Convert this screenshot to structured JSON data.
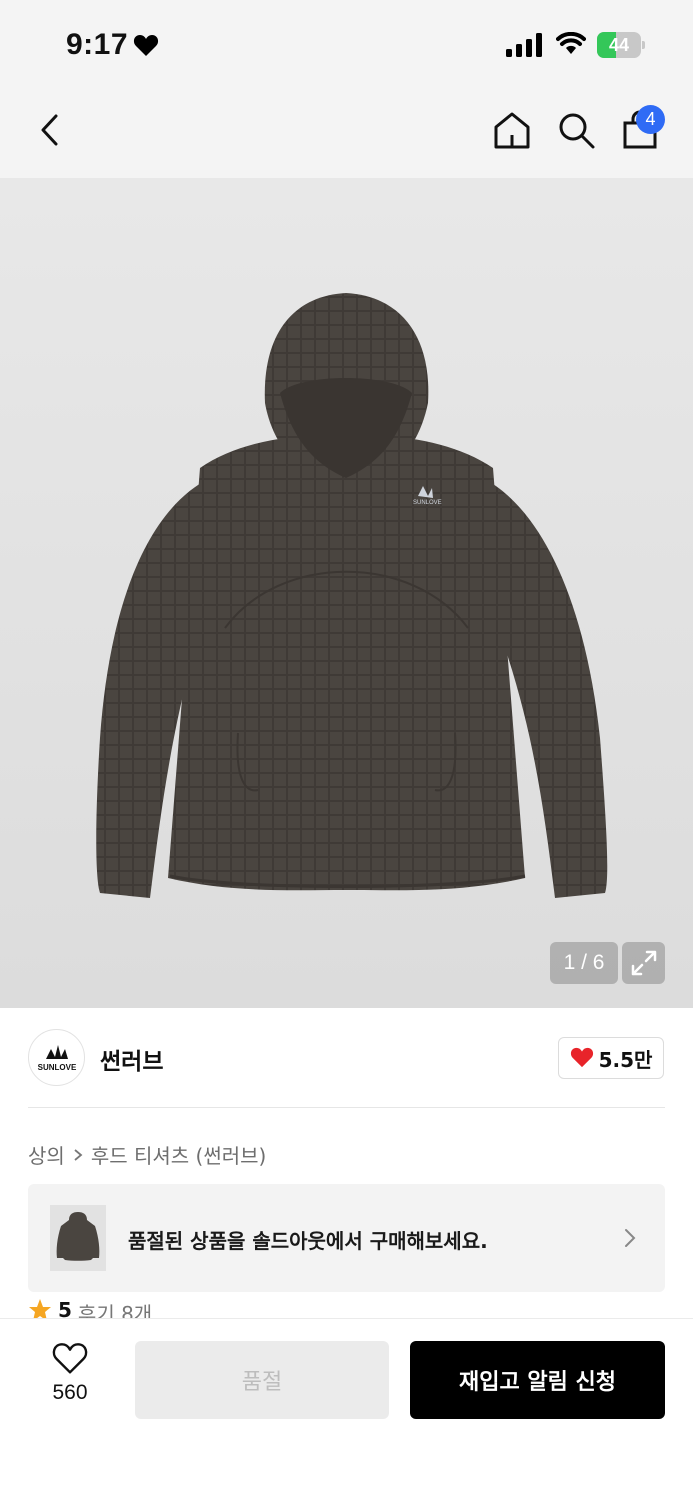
{
  "status_bar": {
    "time": "9:17",
    "battery_level": "44",
    "battery_fraction": 0.44,
    "icons": [
      "heart-icon",
      "signal-icon",
      "wifi-icon",
      "battery-icon"
    ]
  },
  "nav": {
    "icons": [
      "back-arrow-icon",
      "home-icon",
      "search-icon",
      "shopping-bag-icon"
    ],
    "cart_count": "4"
  },
  "gallery": {
    "counter": "1 / 6",
    "logo_text": "SUNLOVE",
    "icons": [
      "expand-icon"
    ]
  },
  "brand": {
    "name": "썬러브",
    "logo_text": "SUNLOVE",
    "like_count": "5.5만"
  },
  "breadcrumb": {
    "level1": "상의",
    "level2": "후드 티셔츠 (썬러브)"
  },
  "soldout_banner": {
    "text": "품절된 상품을 솔드아웃에서 구매해보세요."
  },
  "reviews": {
    "score": "5",
    "label": "후기 8개"
  },
  "bottom_bar": {
    "wish_count": "560",
    "soldout_label": "품절",
    "restock_label": "재입고 알림 신청"
  },
  "colors": {
    "accent_blue": "#2f6bf5",
    "heart_red": "#e8242a",
    "battery_green": "#34c759",
    "star_orange": "#f5a623",
    "hoodie_brown": "#4a4540"
  }
}
